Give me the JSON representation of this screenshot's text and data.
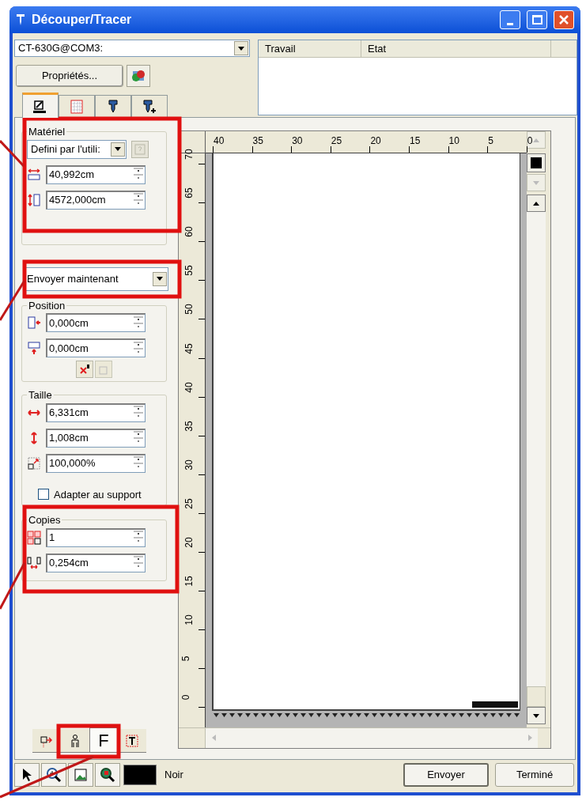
{
  "window": {
    "title": "Découper/Tracer"
  },
  "printer": {
    "value": "CT-630G@COM3:"
  },
  "properties_button": "Propriétés...",
  "job_list": {
    "columns": [
      "Travail",
      "Etat"
    ]
  },
  "tabs": [
    {
      "kind": "media",
      "selected": true
    },
    {
      "kind": "layout",
      "selected": false
    },
    {
      "kind": "tool",
      "selected": false
    },
    {
      "kind": "tool-plus",
      "selected": false
    }
  ],
  "material": {
    "legend": "Matériel",
    "type": "Defini par l'utili:",
    "width": "40,992cm",
    "length": "4572,000cm"
  },
  "send_mode": "Envoyer maintenant",
  "position": {
    "legend": "Position",
    "x": "0,000cm",
    "y": "0,000cm"
  },
  "size": {
    "legend": "Taille",
    "width": "6,331cm",
    "height": "1,008cm",
    "scale": "100,000%",
    "fit_to_media": {
      "label": "Adapter au support",
      "checked": false
    }
  },
  "copies": {
    "legend": "Copies",
    "count": "1",
    "spacing": "0,254cm"
  },
  "rulers": {
    "horizontal": [
      "40",
      "35",
      "30",
      "25",
      "20",
      "15",
      "10",
      "5",
      "0"
    ],
    "vertical": [
      "70",
      "65",
      "60",
      "55",
      "50",
      "45",
      "40",
      "35",
      "30",
      "25",
      "20",
      "15",
      "10",
      "5",
      "0"
    ]
  },
  "mode_buttons": [
    {
      "kind": "move",
      "selected": false
    },
    {
      "kind": "person",
      "selected": false
    },
    {
      "kind": "font",
      "label": "F",
      "selected": true
    },
    {
      "kind": "text-frame",
      "selected": false
    }
  ],
  "pen": {
    "label": "Noir",
    "color": "#000000"
  },
  "buttons": [
    "Envoyer",
    "Terminé"
  ]
}
